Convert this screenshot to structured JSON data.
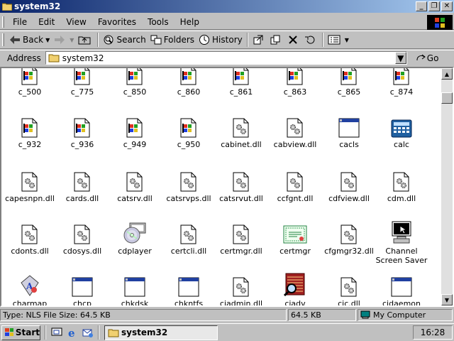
{
  "window": {
    "title": "system32"
  },
  "menu": [
    "File",
    "Edit",
    "View",
    "Favorites",
    "Tools",
    "Help"
  ],
  "toolbar": {
    "back": "Back",
    "search": "Search",
    "folders": "Folders",
    "history": "History"
  },
  "address": {
    "label": "Address",
    "value": "system32",
    "go": "Go"
  },
  "files": [
    {
      "name": "c_500",
      "icon": "nls-file-icon"
    },
    {
      "name": "c_775",
      "icon": "nls-file-icon"
    },
    {
      "name": "c_850",
      "icon": "nls-file-icon"
    },
    {
      "name": "c_860",
      "icon": "nls-file-icon"
    },
    {
      "name": "c_861",
      "icon": "nls-file-icon"
    },
    {
      "name": "c_863",
      "icon": "nls-file-icon"
    },
    {
      "name": "c_865",
      "icon": "nls-file-icon"
    },
    {
      "name": "c_874",
      "icon": "nls-file-icon"
    },
    {
      "name": "c_932",
      "icon": "nls-file-icon"
    },
    {
      "name": "c_936",
      "icon": "nls-file-icon"
    },
    {
      "name": "c_949",
      "icon": "nls-file-icon"
    },
    {
      "name": "c_950",
      "icon": "nls-file-icon"
    },
    {
      "name": "cabinet.dll",
      "icon": "dll-file-icon"
    },
    {
      "name": "cabview.dll",
      "icon": "dll-file-icon"
    },
    {
      "name": "cacls",
      "icon": "app-window-icon"
    },
    {
      "name": "calc",
      "icon": "calculator-icon"
    },
    {
      "name": "capesnpn.dll",
      "icon": "dll-file-icon"
    },
    {
      "name": "cards.dll",
      "icon": "dll-file-icon"
    },
    {
      "name": "catsrv.dll",
      "icon": "dll-file-icon"
    },
    {
      "name": "catsrvps.dll",
      "icon": "dll-file-icon"
    },
    {
      "name": "catsrvut.dll",
      "icon": "dll-file-icon"
    },
    {
      "name": "ccfgnt.dll",
      "icon": "dll-file-icon"
    },
    {
      "name": "cdfview.dll",
      "icon": "dll-file-icon"
    },
    {
      "name": "cdm.dll",
      "icon": "dll-file-icon"
    },
    {
      "name": "cdonts.dll",
      "icon": "dll-file-icon"
    },
    {
      "name": "cdosys.dll",
      "icon": "dll-file-icon"
    },
    {
      "name": "cdplayer",
      "icon": "cd-player-icon"
    },
    {
      "name": "certcli.dll",
      "icon": "dll-file-icon"
    },
    {
      "name": "certmgr.dll",
      "icon": "dll-file-icon"
    },
    {
      "name": "certmgr",
      "icon": "certificate-icon"
    },
    {
      "name": "cfgmgr32.dll",
      "icon": "dll-file-icon"
    },
    {
      "name": "Channel Screen Saver",
      "icon": "screen-saver-icon"
    },
    {
      "name": "charmap",
      "icon": "charmap-icon"
    },
    {
      "name": "chcp",
      "icon": "app-window-icon"
    },
    {
      "name": "chkdsk",
      "icon": "app-window-icon"
    },
    {
      "name": "chkntfs",
      "icon": "app-window-icon"
    },
    {
      "name": "ciadmin.dll",
      "icon": "dll-file-icon"
    },
    {
      "name": "ciadv",
      "icon": "indexing-icon"
    },
    {
      "name": "cic.dll",
      "icon": "dll-file-icon"
    },
    {
      "name": "cidaemon",
      "icon": "app-window-icon"
    }
  ],
  "status": {
    "info": "Type: NLS File Size: 64.5 KB",
    "size": "64.5 KB",
    "zone": "My Computer"
  },
  "taskbar": {
    "start": "Start",
    "window": "system32",
    "clock": "16:28"
  }
}
